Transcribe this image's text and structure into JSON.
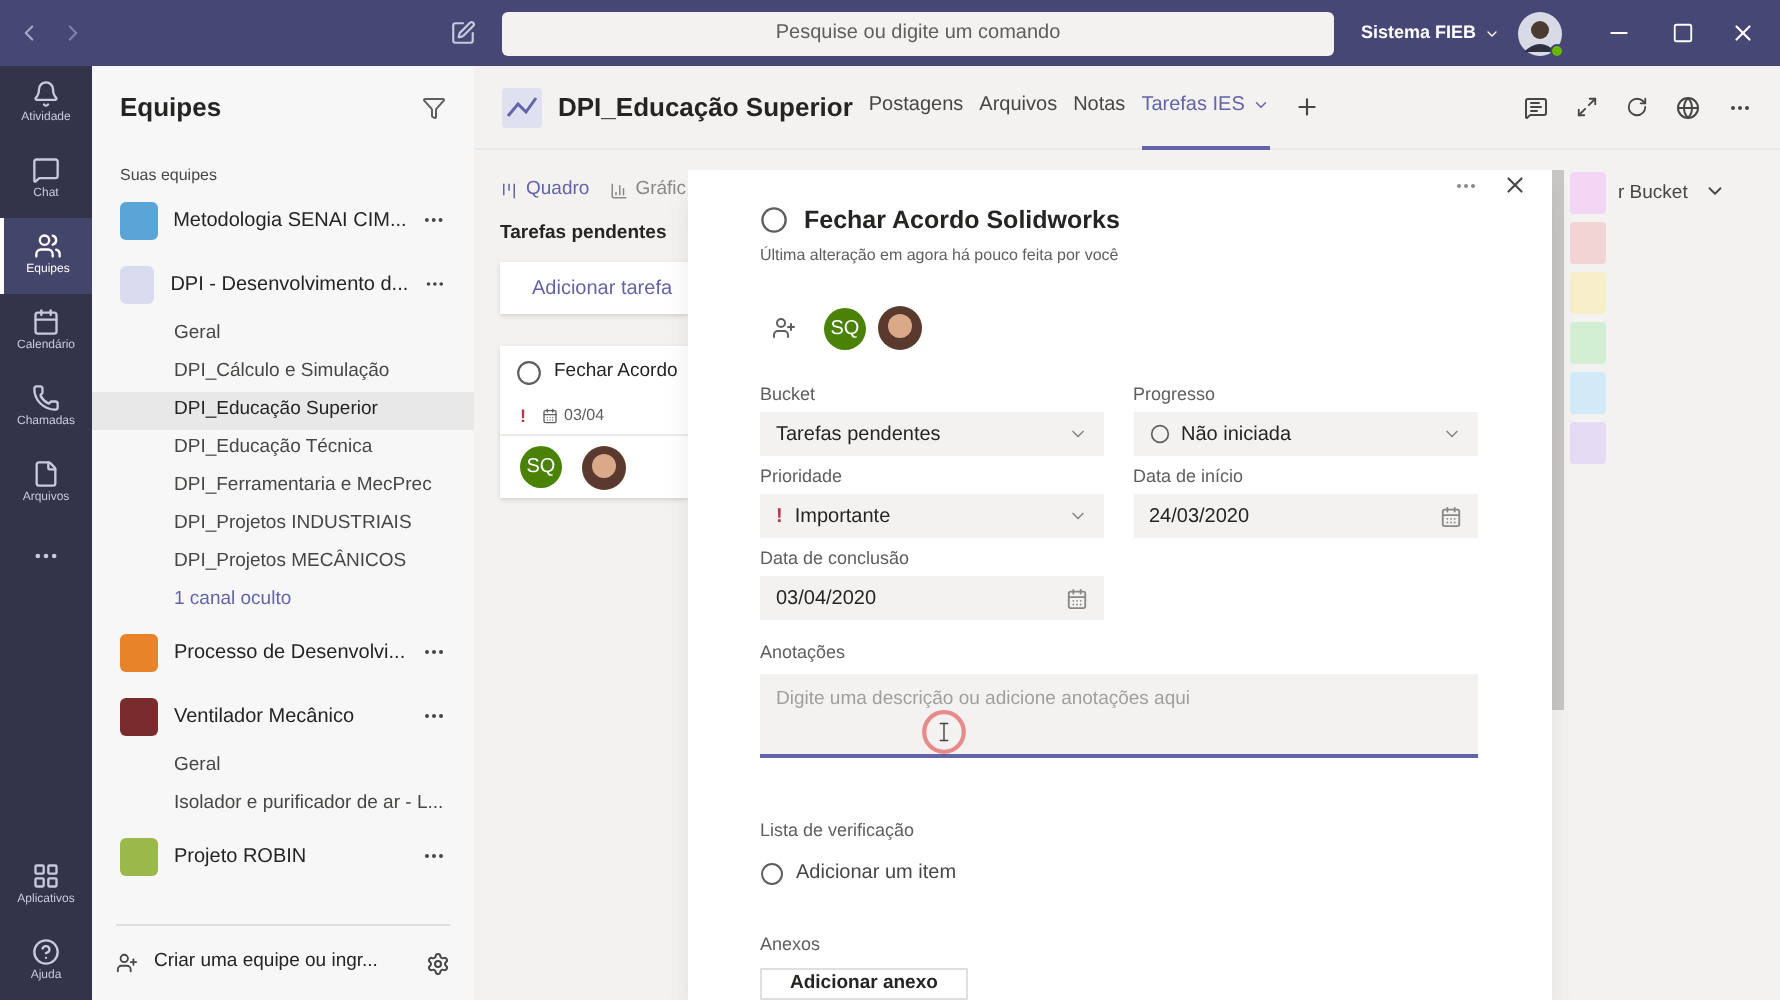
{
  "title_bar": {
    "search": {
      "placeholder": "Pesquise ou digite um comando"
    },
    "org": "Sistema FIEB"
  },
  "rail": [
    {
      "label": "Atividade",
      "selected": false
    },
    {
      "label": "Chat",
      "selected": false
    },
    {
      "label": "Equipes",
      "selected": true
    },
    {
      "label": "Calendário",
      "selected": false
    },
    {
      "label": "Chamadas",
      "selected": false
    },
    {
      "label": "Arquivos",
      "selected": false
    }
  ],
  "rail_bottom": [
    {
      "label": "Aplicativos"
    },
    {
      "label": "Ajuda"
    }
  ],
  "sidebar": {
    "title": "Equipes",
    "section": "Suas equipes",
    "teams": [
      {
        "name": "Metodologia SENAI CIM...",
        "color": "#5ba4d6"
      },
      {
        "name": "DPI - Desenvolvimento d...",
        "color": "#d9dcef",
        "hidden_channels": "1 canal oculto",
        "children": [
          {
            "name": "Geral",
            "selected": false
          },
          {
            "name": "DPI_Cálculo e Simulação",
            "selected": false
          },
          {
            "name": "DPI_Educação Superior",
            "selected": true
          },
          {
            "name": "DPI_Educação Técnica",
            "selected": false
          },
          {
            "name": "DPI_Ferramentaria e MecPrec",
            "selected": false
          },
          {
            "name": "DPI_Projetos INDUSTRIAIS",
            "selected": false
          },
          {
            "name": "DPI_Projetos MECÂNICOS",
            "selected": false
          }
        ]
      },
      {
        "name": "Processo de Desenvolvi...",
        "color": "#e8832a"
      },
      {
        "name": "Ventilador Mecânico",
        "color": "#7a2c2c",
        "children": [
          {
            "name": "Geral",
            "selected": false
          },
          {
            "name": "Isolador e purificador de ar - L...",
            "selected": false
          }
        ]
      },
      {
        "name": "Projeto ROBIN",
        "color": "#9bb84a"
      }
    ],
    "footer": "Criar uma equipe ou ingr..."
  },
  "header": {
    "title": "DPI_Educação Superior",
    "tabs": [
      {
        "label": "Postagens",
        "selected": false
      },
      {
        "label": "Arquivos",
        "selected": false
      },
      {
        "label": "Notas",
        "selected": false
      },
      {
        "label": "Tarefas IES",
        "selected": true
      }
    ]
  },
  "board": {
    "views": [
      {
        "label": "Quadro",
        "selected": true
      },
      {
        "label": "Gráfic",
        "selected": false
      }
    ],
    "column": "Tarefas pendentes",
    "add_task": "Adicionar tarefa",
    "card": {
      "title": "Fechar Acordo",
      "due": "03/04",
      "priority_mark": "!",
      "assignee": "SQ"
    }
  },
  "task": {
    "title": "Fechar Acordo Solidworks",
    "subtitle": "Última alteração em agora há pouco feita por você",
    "assignee": "SQ",
    "bucket": {
      "label": "Bucket",
      "value": "Tarefas pendentes"
    },
    "progress": {
      "label": "Progresso",
      "value": "Não iniciada"
    },
    "priority": {
      "label": "Prioridade",
      "mark": "!",
      "value": "Importante"
    },
    "start": {
      "label": "Data de início",
      "value": "24/03/2020"
    },
    "due": {
      "label": "Data de conclusão",
      "value": "03/04/2020"
    },
    "notes": {
      "label": "Anotações",
      "placeholder": "Digite uma descrição ou adicione anotações aqui"
    },
    "checklist": {
      "label": "Lista de verificação",
      "add": "Adicionar um item"
    },
    "attachments": {
      "label": "Anexos",
      "button": "Adicionar anexo"
    }
  },
  "labels": {
    "text": "r Bucket",
    "swatches": [
      {
        "color": "#f3d6f3"
      },
      {
        "color": "#f3d4d4"
      },
      {
        "color": "#f6efc9"
      },
      {
        "color": "#d3efd3"
      },
      {
        "color": "#d2e9f7"
      },
      {
        "color": "#e6dbf4"
      }
    ]
  }
}
